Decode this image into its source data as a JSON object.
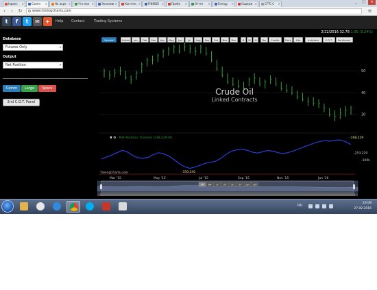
{
  "browser": {
    "tabs": [
      {
        "label": "Індекс",
        "color": "#d04b3c"
      },
      {
        "label": "Comm",
        "color": "#2f6fb3",
        "active": true
      },
      {
        "label": "На акре",
        "color": "#e07b1f"
      },
      {
        "label": "Что пок",
        "color": "#3b8d3b"
      },
      {
        "label": "Экономи",
        "color": "#3c63a8"
      },
      {
        "label": "Контекс",
        "color": "#d43c2f"
      },
      {
        "label": "FINKIDE",
        "color": "#3c63a8"
      },
      {
        "label": "Прибо",
        "color": "#c53b3b"
      },
      {
        "label": "Отчет",
        "color": "#3a8f4a"
      },
      {
        "label": "Energy",
        "color": "#3c63a8"
      },
      {
        "label": "Содерж",
        "color": "#c53b3b"
      },
      {
        "label": "CFTC C",
        "color": "#999999"
      }
    ],
    "url": "www.timingcharts.com",
    "min_label": "_",
    "max_label": "□",
    "close_label": "✕"
  },
  "site": {
    "social": [
      {
        "icon": "tumblr-icon",
        "glyph": "t",
        "color": "#35465c"
      },
      {
        "icon": "facebook-icon",
        "glyph": "f",
        "color": "#3b5998"
      },
      {
        "icon": "twitter-icon",
        "glyph": "t",
        "color": "#1da1f2"
      },
      {
        "icon": "email-icon",
        "glyph": "✉",
        "color": "#555555"
      },
      {
        "icon": "add-icon",
        "glyph": "+",
        "color": "#e4572e"
      }
    ],
    "nav": [
      "Help",
      "Contact",
      "Trading Systems"
    ]
  },
  "left_panel": {
    "database_label": "Database",
    "database_value": "Futures Only",
    "output_label": "Output",
    "output_value": "Net Position",
    "buttons": [
      {
        "label": "Comm",
        "color": "#2e7fb8"
      },
      {
        "label": "Large",
        "color": "#3aa04a"
      },
      {
        "label": "Specs",
        "color": "#d9534f"
      }
    ],
    "panel_button": "2nd C.O.T. Panel"
  },
  "toolbar": {
    "symbol": "Symbol",
    "items": [
      "Linked",
      "Jan",
      "Feb",
      "Mar",
      "Apr",
      "May",
      "Jun",
      "Jul",
      "Aug",
      "Sep",
      "Oct",
      "Nov",
      "Dec"
    ],
    "periods": [
      "D",
      "W",
      "M"
    ],
    "types": [
      "Bar",
      "Candle"
    ],
    "themes": [
      "Dark",
      "Lite"
    ],
    "tools": [
      "Indicator",
      "C.O.T.",
      "Sentiment"
    ]
  },
  "readout": {
    "date": "2/22/2016",
    "price": "32.78",
    "change": "1.05 (3.24%)"
  },
  "chart_title": "Crude Oil",
  "chart_subtitle": "Linked Contracts",
  "cot_legend": "Net Position: [Comm] -218,229.00",
  "cot_legend_toggle": "✖ ⚙",
  "watermark": "TimingCharts.com",
  "navigator": {
    "zoom_buttons": [
      "3M",
      "6M",
      "1Y",
      "2Y",
      "3Y",
      "5Y",
      "10Y",
      "20Y"
    ]
  },
  "chart_data": {
    "type": "bar",
    "title": "Crude Oil",
    "subtitle": "Linked Contracts",
    "price_axis": {
      "ticks": [
        50,
        40,
        30
      ],
      "ylim": [
        26,
        63
      ]
    },
    "x_tick_labels": [
      "Mar '15",
      "May '15",
      "Jul '15",
      "Sep '15",
      "Nov '15",
      "Jan '16"
    ],
    "price_bars": [
      {
        "x": 0,
        "high": 51,
        "low": 47,
        "close": 50
      },
      {
        "x": 1,
        "high": 50,
        "low": 46,
        "close": 48
      },
      {
        "x": 2,
        "high": 51,
        "low": 47,
        "close": 49
      },
      {
        "x": 3,
        "high": 52,
        "low": 48,
        "close": 50
      },
      {
        "x": 4,
        "high": 50,
        "low": 46,
        "close": 47
      },
      {
        "x": 5,
        "high": 48,
        "low": 44,
        "close": 46
      },
      {
        "x": 6,
        "high": 50,
        "low": 46,
        "close": 49
      },
      {
        "x": 7,
        "high": 54,
        "low": 49,
        "close": 53
      },
      {
        "x": 8,
        "high": 56,
        "low": 52,
        "close": 55
      },
      {
        "x": 9,
        "high": 57,
        "low": 53,
        "close": 55
      },
      {
        "x": 10,
        "high": 58,
        "low": 54,
        "close": 57
      },
      {
        "x": 11,
        "high": 60,
        "low": 56,
        "close": 59
      },
      {
        "x": 12,
        "high": 61,
        "low": 57,
        "close": 60
      },
      {
        "x": 13,
        "high": 62,
        "low": 58,
        "close": 61
      },
      {
        "x": 14,
        "high": 62,
        "low": 58,
        "close": 59
      },
      {
        "x": 15,
        "high": 63,
        "low": 59,
        "close": 61
      },
      {
        "x": 16,
        "high": 62,
        "low": 58,
        "close": 60
      },
      {
        "x": 17,
        "high": 61,
        "low": 57,
        "close": 59
      },
      {
        "x": 18,
        "high": 62,
        "low": 58,
        "close": 61
      },
      {
        "x": 19,
        "high": 61,
        "low": 57,
        "close": 58
      },
      {
        "x": 20,
        "high": 59,
        "low": 54,
        "close": 55
      },
      {
        "x": 21,
        "high": 55,
        "low": 50,
        "close": 51
      },
      {
        "x": 22,
        "high": 52,
        "low": 47,
        "close": 48
      },
      {
        "x": 23,
        "high": 49,
        "low": 44,
        "close": 45
      },
      {
        "x": 24,
        "high": 47,
        "low": 43,
        "close": 44
      },
      {
        "x": 25,
        "high": 46,
        "low": 42,
        "close": 43
      },
      {
        "x": 26,
        "high": 45,
        "low": 41,
        "close": 42
      },
      {
        "x": 27,
        "high": 47,
        "low": 43,
        "close": 46
      },
      {
        "x": 28,
        "high": 49,
        "low": 44,
        "close": 47
      },
      {
        "x": 29,
        "high": 47,
        "low": 43,
        "close": 44
      },
      {
        "x": 30,
        "high": 46,
        "low": 42,
        "close": 45
      },
      {
        "x": 31,
        "high": 48,
        "low": 44,
        "close": 46
      },
      {
        "x": 32,
        "high": 47,
        "low": 43,
        "close": 44
      },
      {
        "x": 33,
        "high": 45,
        "low": 41,
        "close": 42
      },
      {
        "x": 34,
        "high": 44,
        "low": 40,
        "close": 41
      },
      {
        "x": 35,
        "high": 43,
        "low": 39,
        "close": 40
      },
      {
        "x": 36,
        "high": 41,
        "low": 37,
        "close": 38
      },
      {
        "x": 37,
        "high": 40,
        "low": 36,
        "close": 37
      },
      {
        "x": 38,
        "high": 38,
        "low": 34,
        "close": 36
      },
      {
        "x": 39,
        "high": 38,
        "low": 34,
        "close": 35
      },
      {
        "x": 40,
        "high": 37,
        "low": 33,
        "close": 35
      },
      {
        "x": 41,
        "high": 35,
        "low": 31,
        "close": 33
      },
      {
        "x": 42,
        "high": 33,
        "low": 29,
        "close": 30
      },
      {
        "x": 43,
        "high": 32,
        "low": 27,
        "close": 29
      },
      {
        "x": 44,
        "high": 33,
        "low": 28,
        "close": 31
      },
      {
        "x": 45,
        "high": 34,
        "low": 29,
        "close": 32
      },
      {
        "x": 46,
        "high": 34,
        "low": 30,
        "close": 33
      }
    ],
    "net_position": {
      "name": "Net Position",
      "labels": [
        "-168,229",
        "-253,229",
        "-300k",
        "-350,540"
      ],
      "ylim": [
        -370000,
        -150000
      ],
      "values": [
        -290000,
        -278000,
        -265000,
        -250000,
        -235000,
        -245000,
        -268000,
        -282000,
        -286000,
        -280000,
        -262000,
        -250000,
        -258000,
        -272000,
        -295000,
        -320000,
        -340000,
        -350540,
        -342000,
        -330000,
        -318000,
        -312000,
        -305000,
        -285000,
        -260000,
        -240000,
        -232000,
        -228000,
        -234000,
        -246000,
        -252000,
        -244000,
        -236000,
        -240000,
        -250000,
        -256000,
        -248000,
        -238000,
        -225000,
        -212000,
        -200000,
        -188000,
        -178000,
        -172000,
        -176000,
        -170000,
        -168229,
        -180000,
        -198000
      ]
    }
  }
}
